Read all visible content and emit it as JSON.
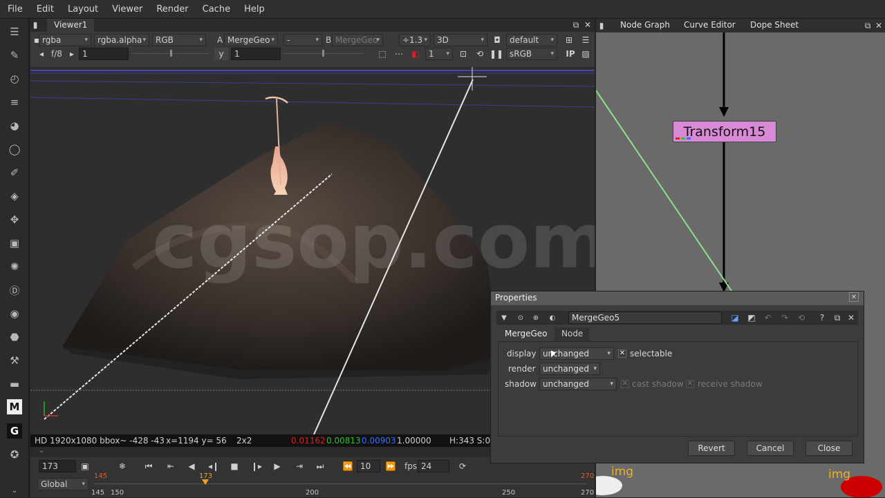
{
  "menu": [
    "File",
    "Edit",
    "Layout",
    "Viewer",
    "Render",
    "Cache",
    "Help"
  ],
  "viewer": {
    "tab": "Viewer1",
    "channels": "rgba",
    "alpha": "rgba.alpha",
    "display_channel": "RGB",
    "a_label": "A",
    "a_input": "MergeGeo",
    "wipe_op": "-",
    "b_label": "B",
    "b_input": "MergeGeo",
    "zoom": "÷1.3",
    "view_mode": "3D",
    "camera": "default",
    "fstop": "f/8",
    "gain_value": "1",
    "gamma_label": "y",
    "gamma_value": "1",
    "frame_count": "1",
    "colorspace": "sRGB",
    "ip_label": "IP",
    "watermark": "cgsop.com",
    "status": {
      "format": "HD 1920x1080 bbox~ -428 -43",
      "coords": "x=1194 y=  56",
      "size": "2x2",
      "r": "0.01162",
      "g": "0.00813",
      "b": "0.00903",
      "a": "1.00000",
      "hsv": "H:343 S:0"
    },
    "timeline": {
      "current_frame": "173",
      "skip_frames": "10",
      "fps_label": "fps",
      "fps": "24",
      "scope": "Global",
      "in_frame": "145",
      "marker_frame": "173",
      "out_frame": "270",
      "ticks": [
        "145",
        "150",
        "200",
        "250",
        "270"
      ]
    }
  },
  "node_graph": {
    "tabs": [
      "Node Graph",
      "Curve Editor",
      "Dope Sheet"
    ],
    "node_label": "Transform15",
    "img_label_1": "img",
    "img_label_2": "img"
  },
  "properties": {
    "title": "Properties",
    "node_name": "MergeGeo5",
    "tabs": [
      "MergeGeo",
      "Node"
    ],
    "display_label": "display",
    "display_value": "unchanged",
    "selectable_label": "selectable",
    "render_label": "render",
    "render_value": "unchanged",
    "shadow_label": "shadow",
    "shadow_value": "unchanged",
    "cast_shadow_label": "cast shadow",
    "receive_shadow_label": "receive shadow",
    "buttons": {
      "revert": "Revert",
      "cancel": "Cancel",
      "close": "Close"
    }
  },
  "colors": {
    "node_pink": "#d98ad6",
    "r": "#e02020",
    "g": "#2ec02e",
    "b": "#3b6bff"
  }
}
